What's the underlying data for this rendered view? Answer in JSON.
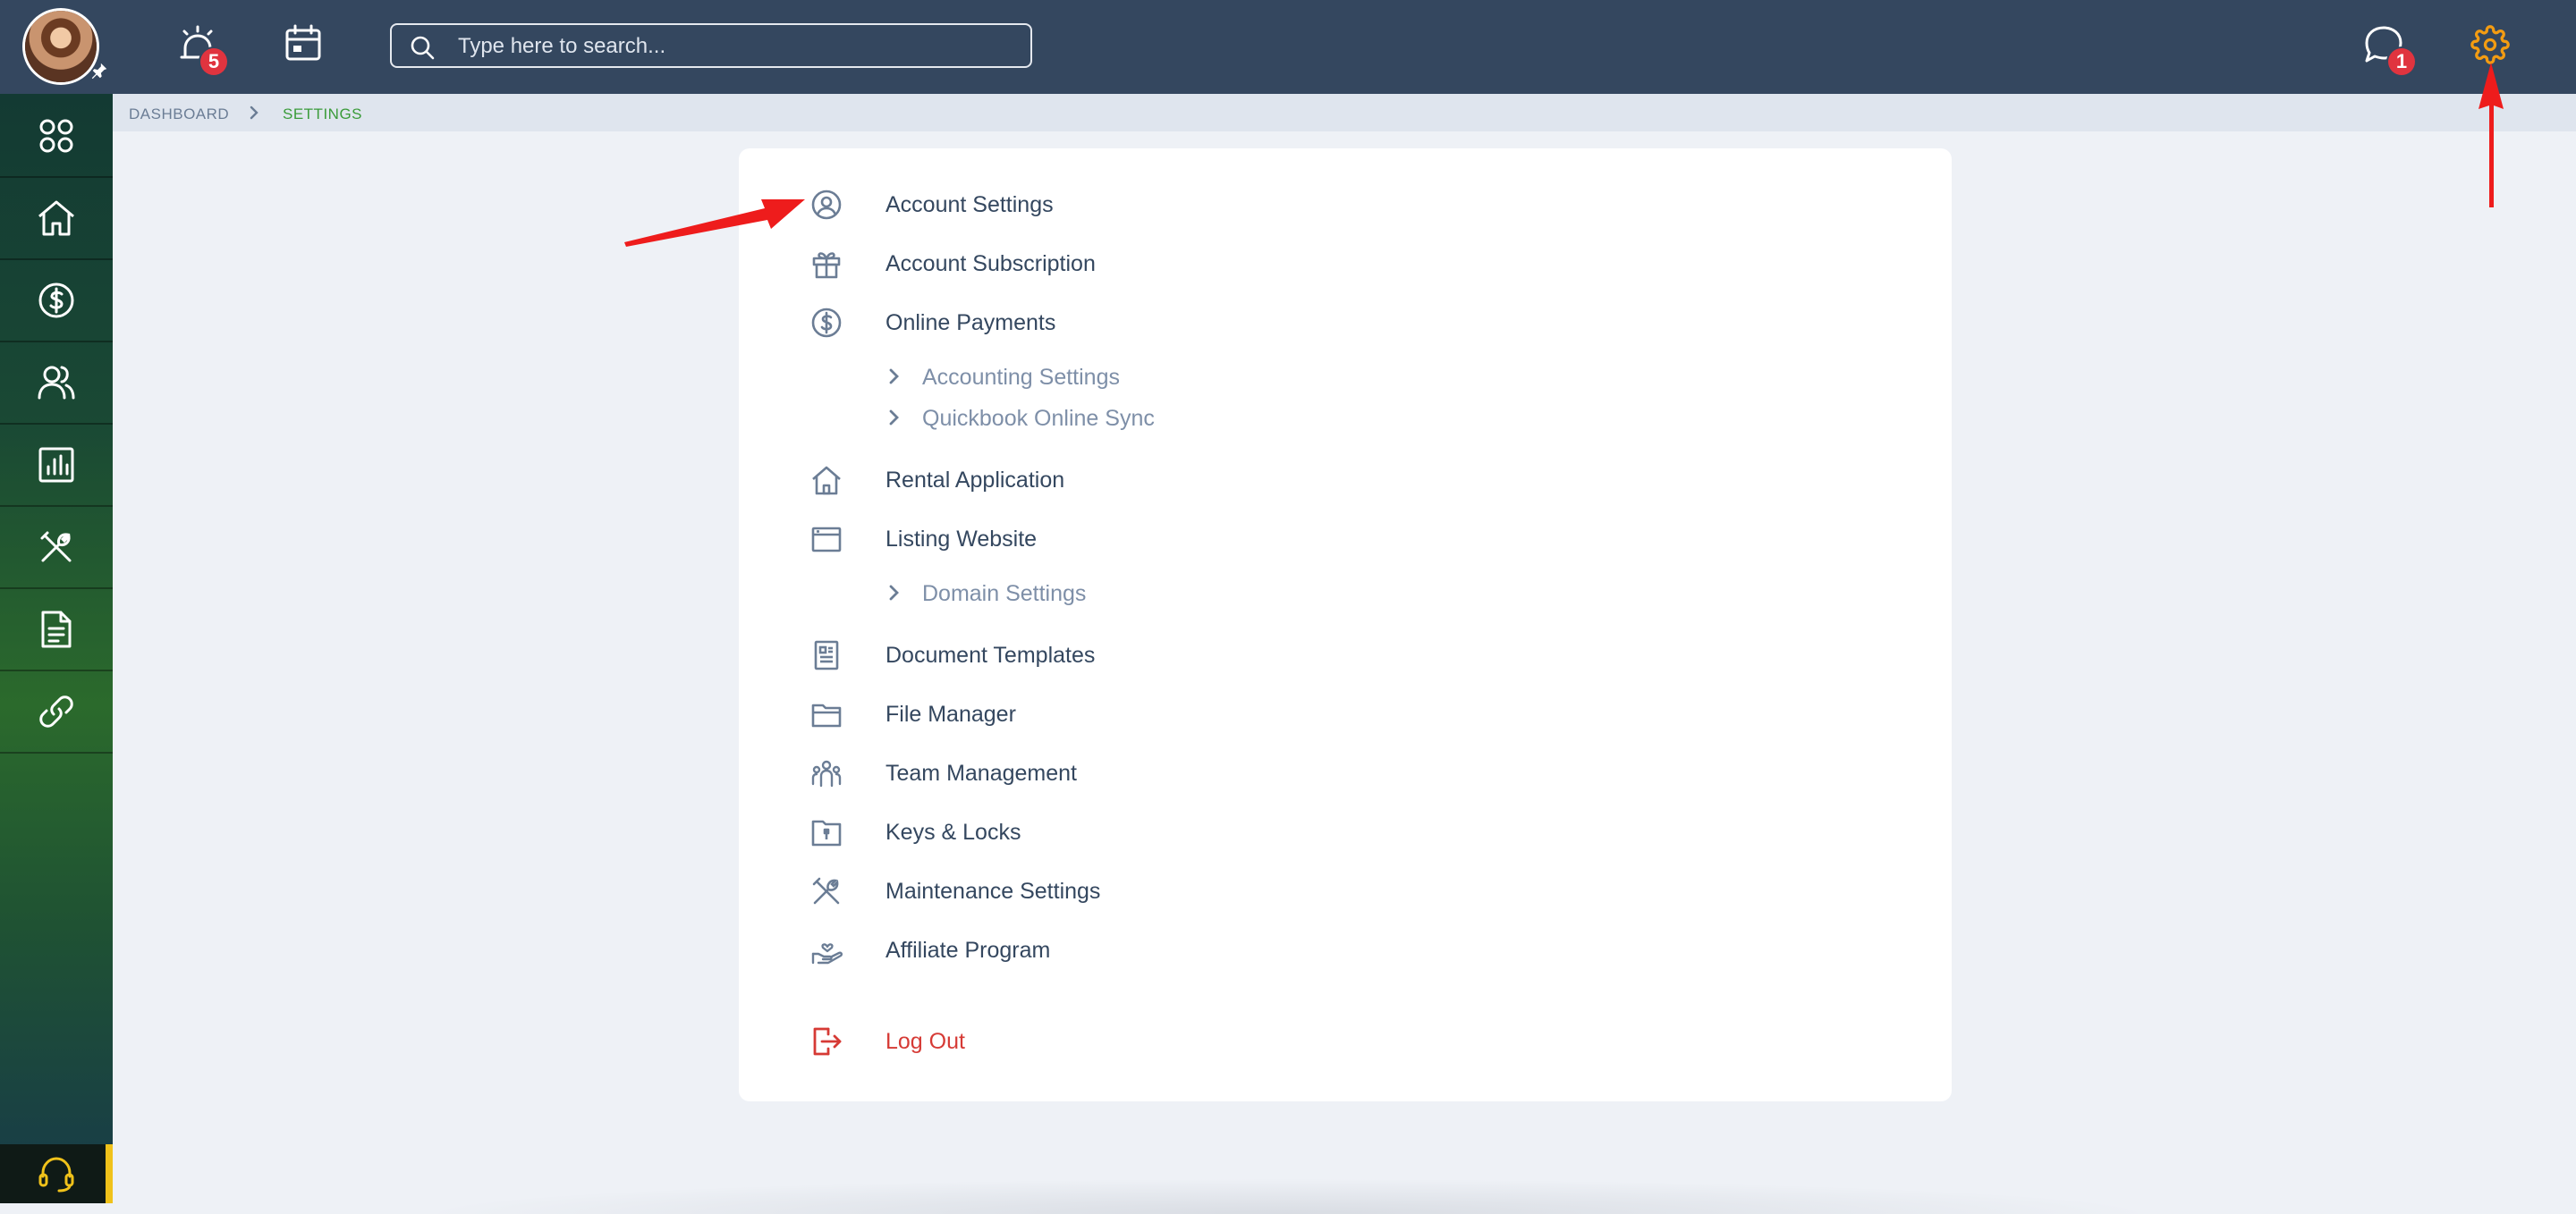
{
  "topbar": {
    "notifications_count": "5",
    "messages_count": "1",
    "search_placeholder": "Type here to search..."
  },
  "breadcrumb": {
    "items": [
      "DASHBOARD",
      "SETTINGS"
    ]
  },
  "sidebar": {
    "items": [
      "apps-icon",
      "home-icon",
      "dollar-icon",
      "people-icon",
      "chart-icon",
      "tools-icon",
      "document-icon",
      "link-icon"
    ],
    "support": "headset-icon",
    "accent_color": "#f0c21a"
  },
  "settings_menu": {
    "account_settings": "Account Settings",
    "account_subscription": "Account Subscription",
    "online_payments": "Online Payments",
    "accounting_settings": "Accounting Settings",
    "quickbook_sync": "Quickbook Online Sync",
    "rental_application": "Rental Application",
    "listing_website": "Listing Website",
    "domain_settings": "Domain Settings",
    "document_templates": "Document Templates",
    "file_manager": "File Manager",
    "team_management": "Team Management",
    "keys_locks": "Keys & Locks",
    "maintenance_settings": "Maintenance Settings",
    "affiliate_program": "Affiliate Program",
    "log_out": "Log Out"
  },
  "colors": {
    "topbar": "#34475f",
    "breadcrumb_active": "#3a9b3a",
    "settings_icon": "#f39c12",
    "badge": "#e0343f",
    "logout": "#d63a35",
    "annotation_arrow": "#ee1c1c"
  }
}
